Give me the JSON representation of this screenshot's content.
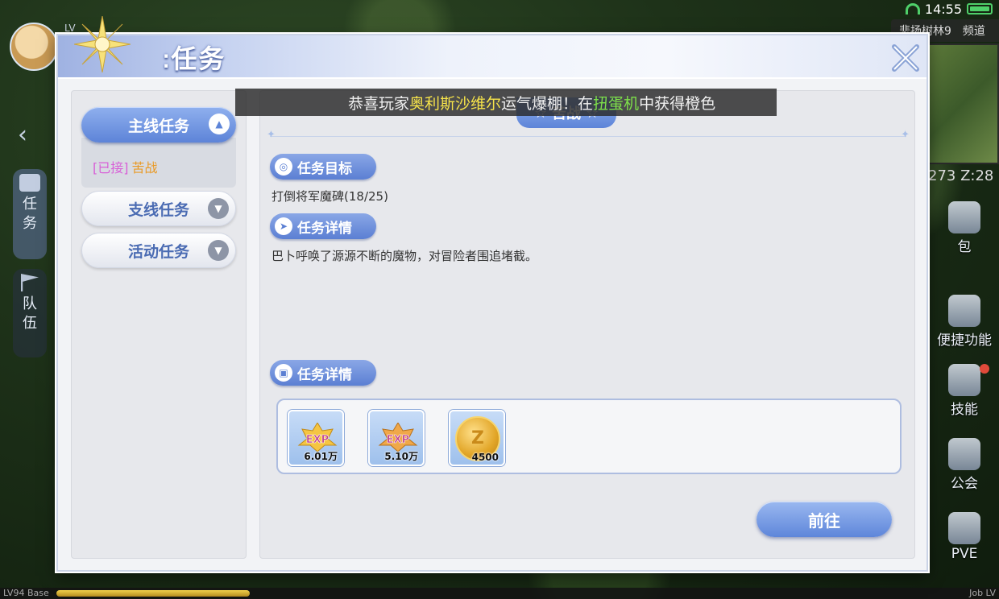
{
  "status_bar": {
    "time": "14:55"
  },
  "hud": {
    "avatar_level": "LV",
    "map_name": "悲扬树林9",
    "channel": "频道",
    "coords": "273 Z:28",
    "bag_label": "包",
    "shortcut_label": "便捷功能",
    "skill_label": "技能",
    "guild_label": "公会",
    "pve_label": "PVE",
    "exp_left": "LV94 Base",
    "exp_right": "Job LV"
  },
  "left_sidebar": {
    "quest_tab": "任务",
    "team_tab": "队伍"
  },
  "dialog": {
    "title": "任务",
    "tabs": [
      {
        "label": "主线任务",
        "state": "expanded"
      },
      {
        "label": "支线任务",
        "state": "collapsed"
      },
      {
        "label": "活动任务",
        "state": "collapsed"
      }
    ],
    "main_quest_item": {
      "tag": "[已接]",
      "name": "苦战"
    },
    "quest_title": "苦战",
    "sections": {
      "objective_title": "任务目标",
      "objective_text": "打倒将军魔碑(18/25)",
      "detail_title": "任务详情",
      "detail_text": "巴卜呼唤了源源不断的魔物，对冒险者围追堵截。",
      "reward_title": "任务详情"
    },
    "rewards": [
      {
        "type": "exp-base",
        "icon_text": "EXP",
        "qty": "6.01万"
      },
      {
        "type": "exp-job",
        "icon_text": "EXP",
        "qty": "5.10万"
      },
      {
        "type": "zeny",
        "icon_text": "Z",
        "qty": "4500"
      }
    ],
    "go_button": "前往"
  },
  "broadcast": {
    "p1": "恭喜玩家",
    "player": "奥利斯沙维尔",
    "p2": "运气爆棚！在",
    "machine": "扭蛋机",
    "p3": "中获得橙色"
  },
  "colors": {
    "accent_blue": "#5d84d8",
    "accepted_tag": "#d85fd7",
    "quest_name": "#e99a26",
    "highlight_yellow": "#f6e34a",
    "highlight_green": "#7ee04a"
  }
}
